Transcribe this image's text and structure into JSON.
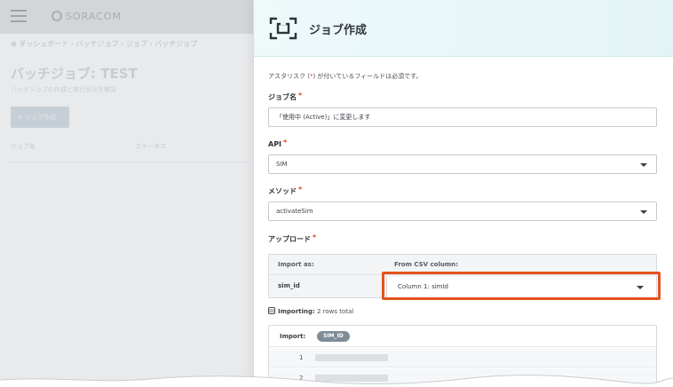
{
  "background": {
    "logo": "SORACOM",
    "breadcrumb": "⊕ ダッシュボード › バッチジョブ › ジョブ › バッチジョブ",
    "title": "バッチジョブ: TEST",
    "subtitle": "バッチジョブの作成と実行状況を確認",
    "button_label": "+ ジョブ作成",
    "columns": [
      "ジョブ名",
      "ステータス"
    ]
  },
  "panel": {
    "title": "ジョブ作成",
    "required_note_prefix": "アスタリスク (",
    "required_note_star": "*",
    "required_note_suffix": ") が付いているフィールドは必須です。",
    "job_name": {
      "label": "ジョブ名",
      "value": "「使用中 (Active)」に変更します"
    },
    "api": {
      "label": "API",
      "value": "SIM"
    },
    "method": {
      "label": "メソッド",
      "value": "activateSim"
    },
    "upload": {
      "label": "アップロード",
      "import_as_header": "Import as:",
      "from_csv_header": "From CSV column:",
      "key": "sim_id",
      "column_value": "Column 1: simId"
    },
    "importing": {
      "label": "Importing:",
      "detail": "2 rows total"
    },
    "preview": {
      "import_label": "Import:",
      "pill": "SIM_ID",
      "rows": [
        "1",
        "2"
      ]
    },
    "required_star": "*"
  },
  "colors": {
    "highlight": "#e4521c",
    "required": "#e0412a",
    "header_bg": "#e3f4f7"
  }
}
